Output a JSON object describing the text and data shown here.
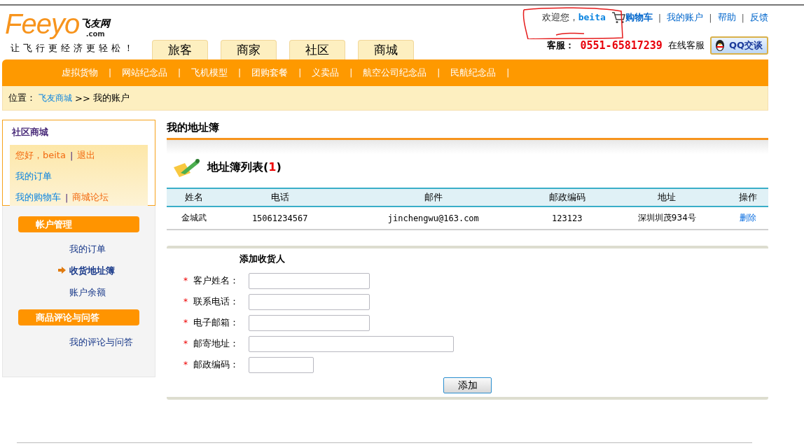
{
  "logo": {
    "brand": "Feeyo",
    "name": "飞友网",
    "domain": ".com",
    "slogan": "让飞行更经济更轻松！"
  },
  "top_links": {
    "welcome": "欢迎您，",
    "user": "beita",
    "cart": "购物车",
    "links": [
      "我的账户",
      "帮助",
      "反馈"
    ],
    "separators": [
      "|",
      "|",
      "|"
    ]
  },
  "service": {
    "label": "客服：",
    "phone": "0551-65817239",
    "online": "在线客服",
    "qq_button": "QQ交谈"
  },
  "tabs": [
    "旅客",
    "商家",
    "社区",
    "商城"
  ],
  "nav": {
    "items": [
      "虚拟货物",
      "网站纪念品",
      "飞机模型",
      "团购套餐",
      "义卖品",
      "航空公司纪念品",
      "民航纪念品"
    ],
    "separators": [
      "|",
      "|",
      "|",
      "|",
      "|",
      "|",
      "|"
    ]
  },
  "breadcrumb": {
    "label": "位置：",
    "home": "飞友商城",
    "separator": ">>",
    "current": "我的账户"
  },
  "sidebar": {
    "title": "社区商城",
    "greeting": "您好，beita",
    "logout": "退出",
    "orders": "我的订单",
    "cart": "我的购物车",
    "forum": "商城论坛",
    "separators": [
      "|",
      "|"
    ],
    "groups": [
      {
        "title": "帐户管理",
        "items": [
          {
            "label": "我的订单",
            "selected": false
          },
          {
            "label": "收货地址簿",
            "selected": true
          },
          {
            "label": "账户余额",
            "selected": false
          }
        ]
      },
      {
        "title": "商品评论与问答",
        "items": [
          {
            "label": "我的评论与问答",
            "selected": false
          }
        ]
      }
    ]
  },
  "page_title": "我的地址簿",
  "list": {
    "title": "地址簿列表(",
    "count": "1",
    "suffix": ")"
  },
  "table": {
    "columns": [
      "姓名",
      "电话",
      "邮件",
      "邮政编码",
      "地址",
      "操作"
    ],
    "rows": [
      {
        "cells": [
          "金城武",
          "15061234567",
          "jinchengwu@163.com",
          "123123",
          "深圳圳茂934号"
        ],
        "action": "删除"
      }
    ]
  },
  "form": {
    "title": "添加收货人",
    "required_mark": "*",
    "fields": [
      {
        "label": "客户姓名："
      },
      {
        "label": "联系电话："
      },
      {
        "label": "电子邮箱："
      },
      {
        "label": "邮寄地址："
      },
      {
        "label": "邮政编码："
      }
    ],
    "submit": "添加"
  }
}
